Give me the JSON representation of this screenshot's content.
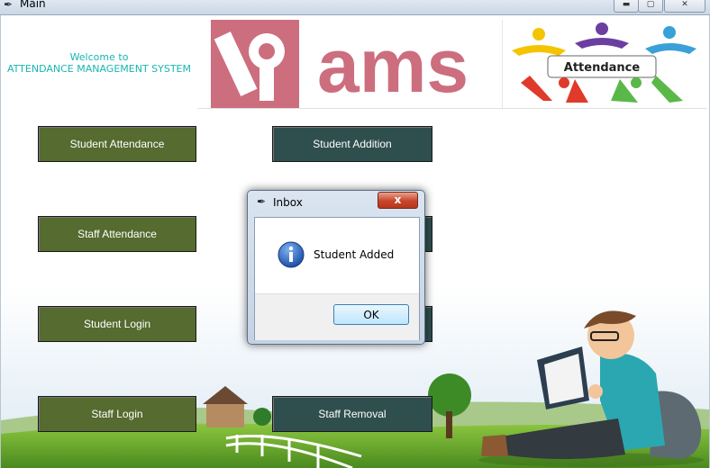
{
  "window": {
    "title": "Main"
  },
  "welcome": {
    "line1": "Welcome to",
    "line2": "ATTENDANCE MANAGEMENT SYSTEM"
  },
  "banner": {
    "logo_text": "ams",
    "attendance_text": "Attendance"
  },
  "buttons": {
    "student_attendance": "Student Attendance",
    "staff_attendance": "Staff Attendance",
    "student_login": "Student Login",
    "staff_login": "Staff Login",
    "student_addition": "Student Addition",
    "staff_removal": "Staff Removal"
  },
  "dialog": {
    "title": "Inbox",
    "message": "Student Added",
    "ok_label": "OK",
    "close_glyph": "x"
  },
  "colors": {
    "green_button": "#556b2f",
    "teal_button": "#2f4f4f",
    "welcome_text": "#18b6b0",
    "logo_pink": "#cc6e7e"
  }
}
